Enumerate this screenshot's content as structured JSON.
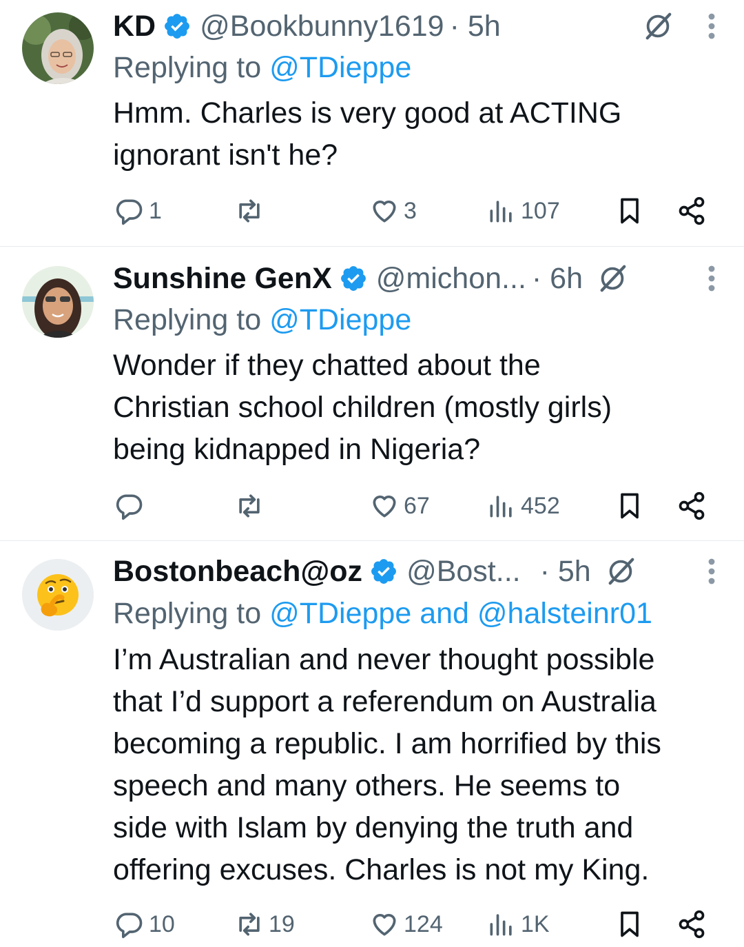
{
  "tweets": [
    {
      "name": "KD",
      "handle": "@Bookbunny1619",
      "time": "· 5h",
      "replying_prefix": "Replying to ",
      "replying_to": "@TDieppe",
      "body_lines": [
        "Hmm. Charles is very good at ACTING",
        "ignorant isn't he?"
      ],
      "replies": "1",
      "reposts": "",
      "likes": "3",
      "views": "107",
      "avatar": "woman-gray-hair-photo"
    },
    {
      "name": "Sunshine GenX",
      "handle": "@michon...",
      "time": "· 6h",
      "replying_prefix": "Replying to ",
      "replying_to": "@TDieppe",
      "body_lines": [
        "Wonder if they chatted about the",
        "Christian school children (mostly girls)",
        "being kidnapped in Nigeria?"
      ],
      "replies": "",
      "reposts": "",
      "likes": "67",
      "views": "452",
      "avatar": "woman-sunglasses-photo"
    },
    {
      "name": "Bostonbeach@oz",
      "handle": "@Bost...",
      "time": "· 5h",
      "replying_prefix": "Replying to ",
      "replying_to": "@TDieppe and @halsteinr01",
      "body_lines": [
        "I’m Australian and never thought possible",
        "that I’d support a referendum on Australia",
        "becoming a republic. I am horrified by this",
        "speech and many others. He seems to",
        "side with Islam by denying the truth and",
        "offering excuses. Charles is not my King."
      ],
      "replies": "10",
      "reposts": "19",
      "likes": "124",
      "views": "1K",
      "avatar": "thinking-face-emoji"
    }
  ],
  "icons": {
    "verified": "verified-badge-icon",
    "grok": "grok-icon",
    "more": "more-vertical-icon",
    "reply": "reply-icon",
    "repost": "repost-icon",
    "like": "heart-icon",
    "views": "views-icon",
    "bookmark": "bookmark-icon",
    "share": "share-icon"
  },
  "colors": {
    "text": "#0f1419",
    "secondary": "#536471",
    "link": "#1d9bf0",
    "divider": "#e6ecf0"
  }
}
